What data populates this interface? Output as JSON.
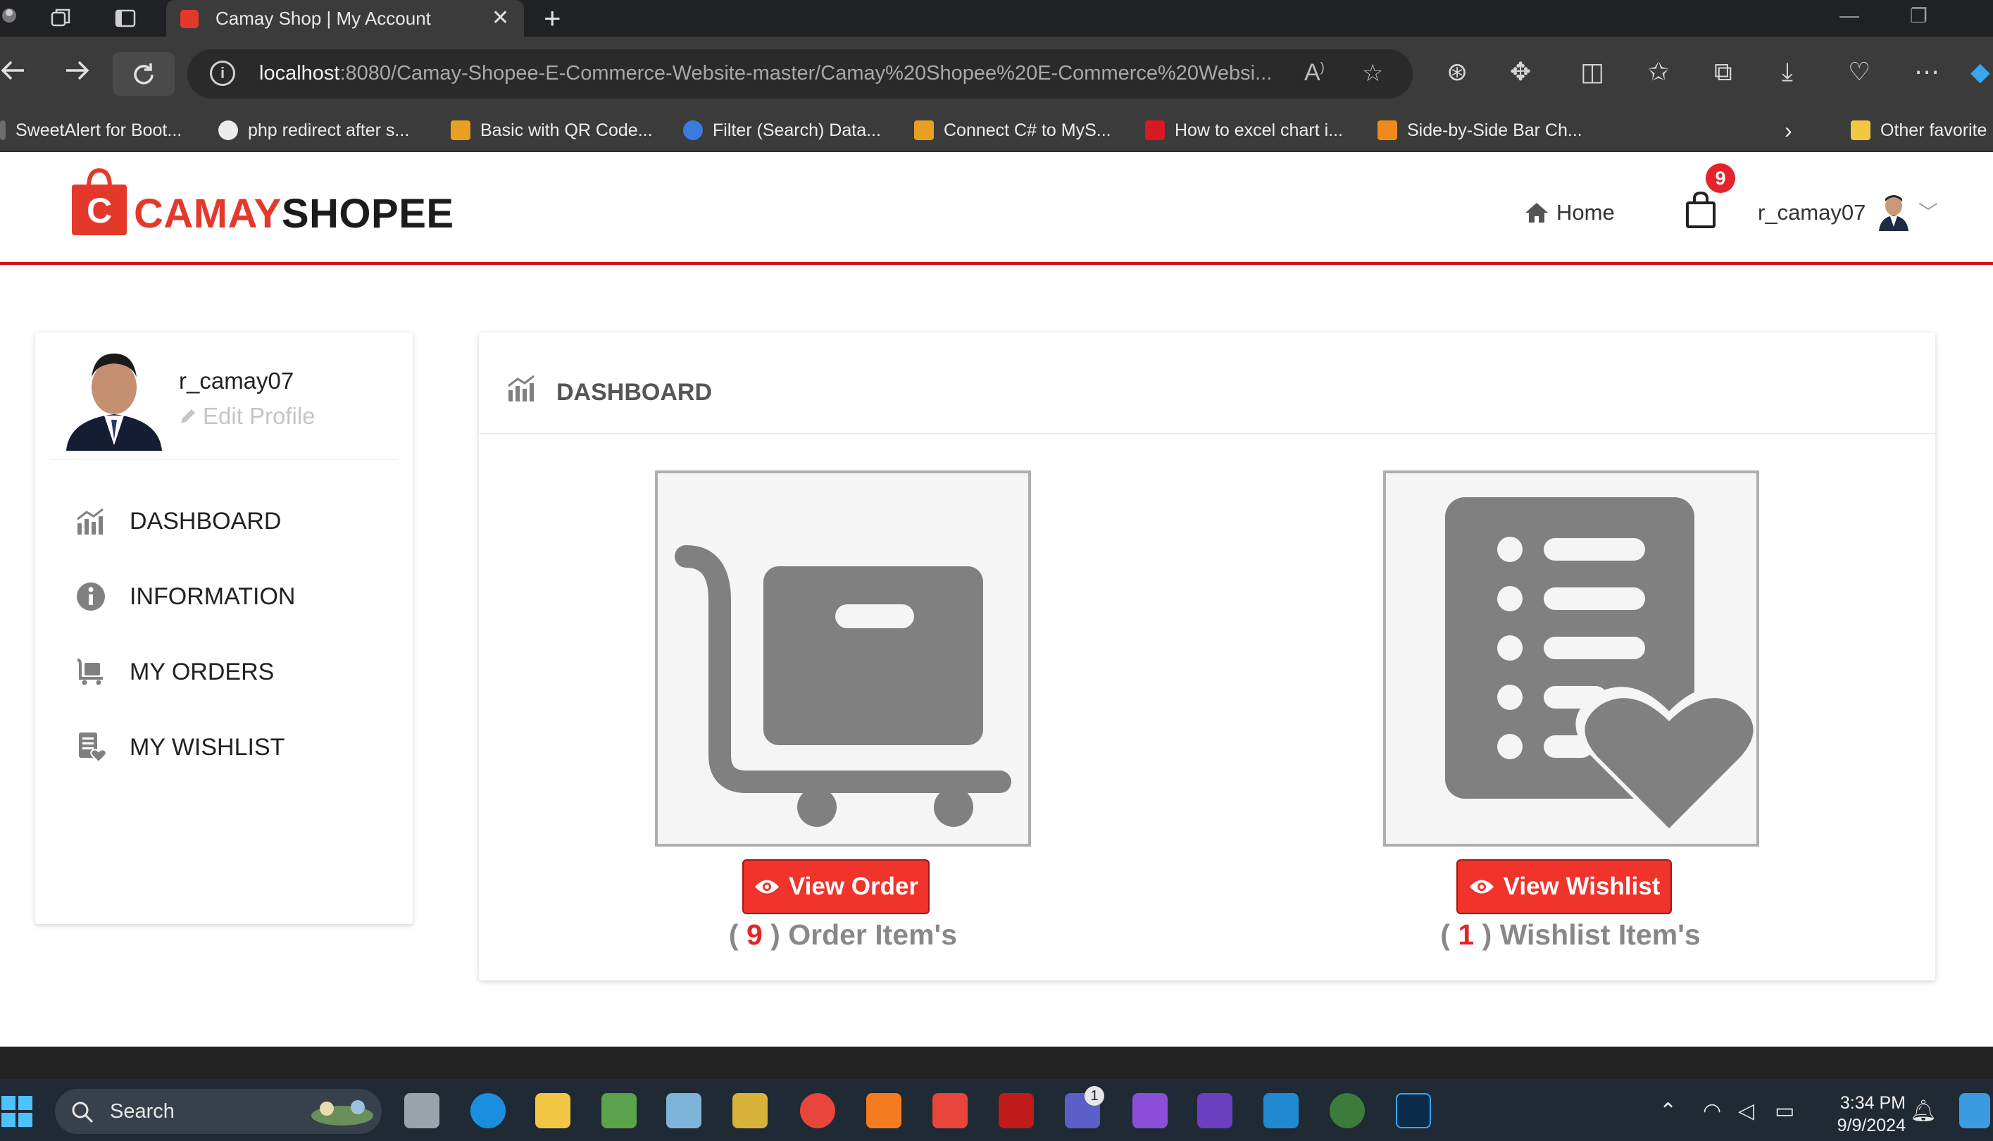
{
  "browser": {
    "tab_title": "Camay Shop | My Account",
    "url_host": "localhost",
    "url_rest": ":8080/Camay-Shopee-E-Commerce-Website-master/Camay%20Shopee%20E-Commerce%20Websi...",
    "bookmarks": [
      "SweetAlert for Boot...",
      "php redirect after s...",
      "Basic with QR Code...",
      "Filter (Search) Data...",
      "Connect C# to MyS...",
      "How to excel chart i...",
      "Side-by-Side Bar Ch...",
      "Other favorite"
    ]
  },
  "header": {
    "logo_part1": "CAMAY",
    "logo_part2": "SHOPEE",
    "logo_letter": "C",
    "home_label": "Home",
    "cart_count": "9",
    "username": "r_camay07"
  },
  "sidebar": {
    "username": "r_camay07",
    "edit_label": "Edit Profile",
    "items": [
      {
        "label": "DASHBOARD",
        "icon": "chart-icon"
      },
      {
        "label": "INFORMATION",
        "icon": "info-icon"
      },
      {
        "label": "MY ORDERS",
        "icon": "cart-icon"
      },
      {
        "label": "MY WISHLIST",
        "icon": "wishlist-icon"
      }
    ]
  },
  "dashboard": {
    "title": "DASHBOARD",
    "orders": {
      "button_label": "View Order",
      "count": "9",
      "count_label": "Order Item's",
      "open": "(",
      "close": ")"
    },
    "wishlist": {
      "button_label": "View Wishlist",
      "count": "1",
      "count_label": "Wishlist Item's",
      "open": "(",
      "close": ")"
    }
  },
  "taskbar": {
    "search_label": "Search",
    "time": "3:34 PM",
    "date": "9/9/2024",
    "teams_badge": "1"
  },
  "colors": {
    "brand_red": "#e4382b",
    "button_red": "#f0332b",
    "badge_red": "#e4242a",
    "header_line": "#d0121a",
    "icon_gray": "#808080"
  }
}
